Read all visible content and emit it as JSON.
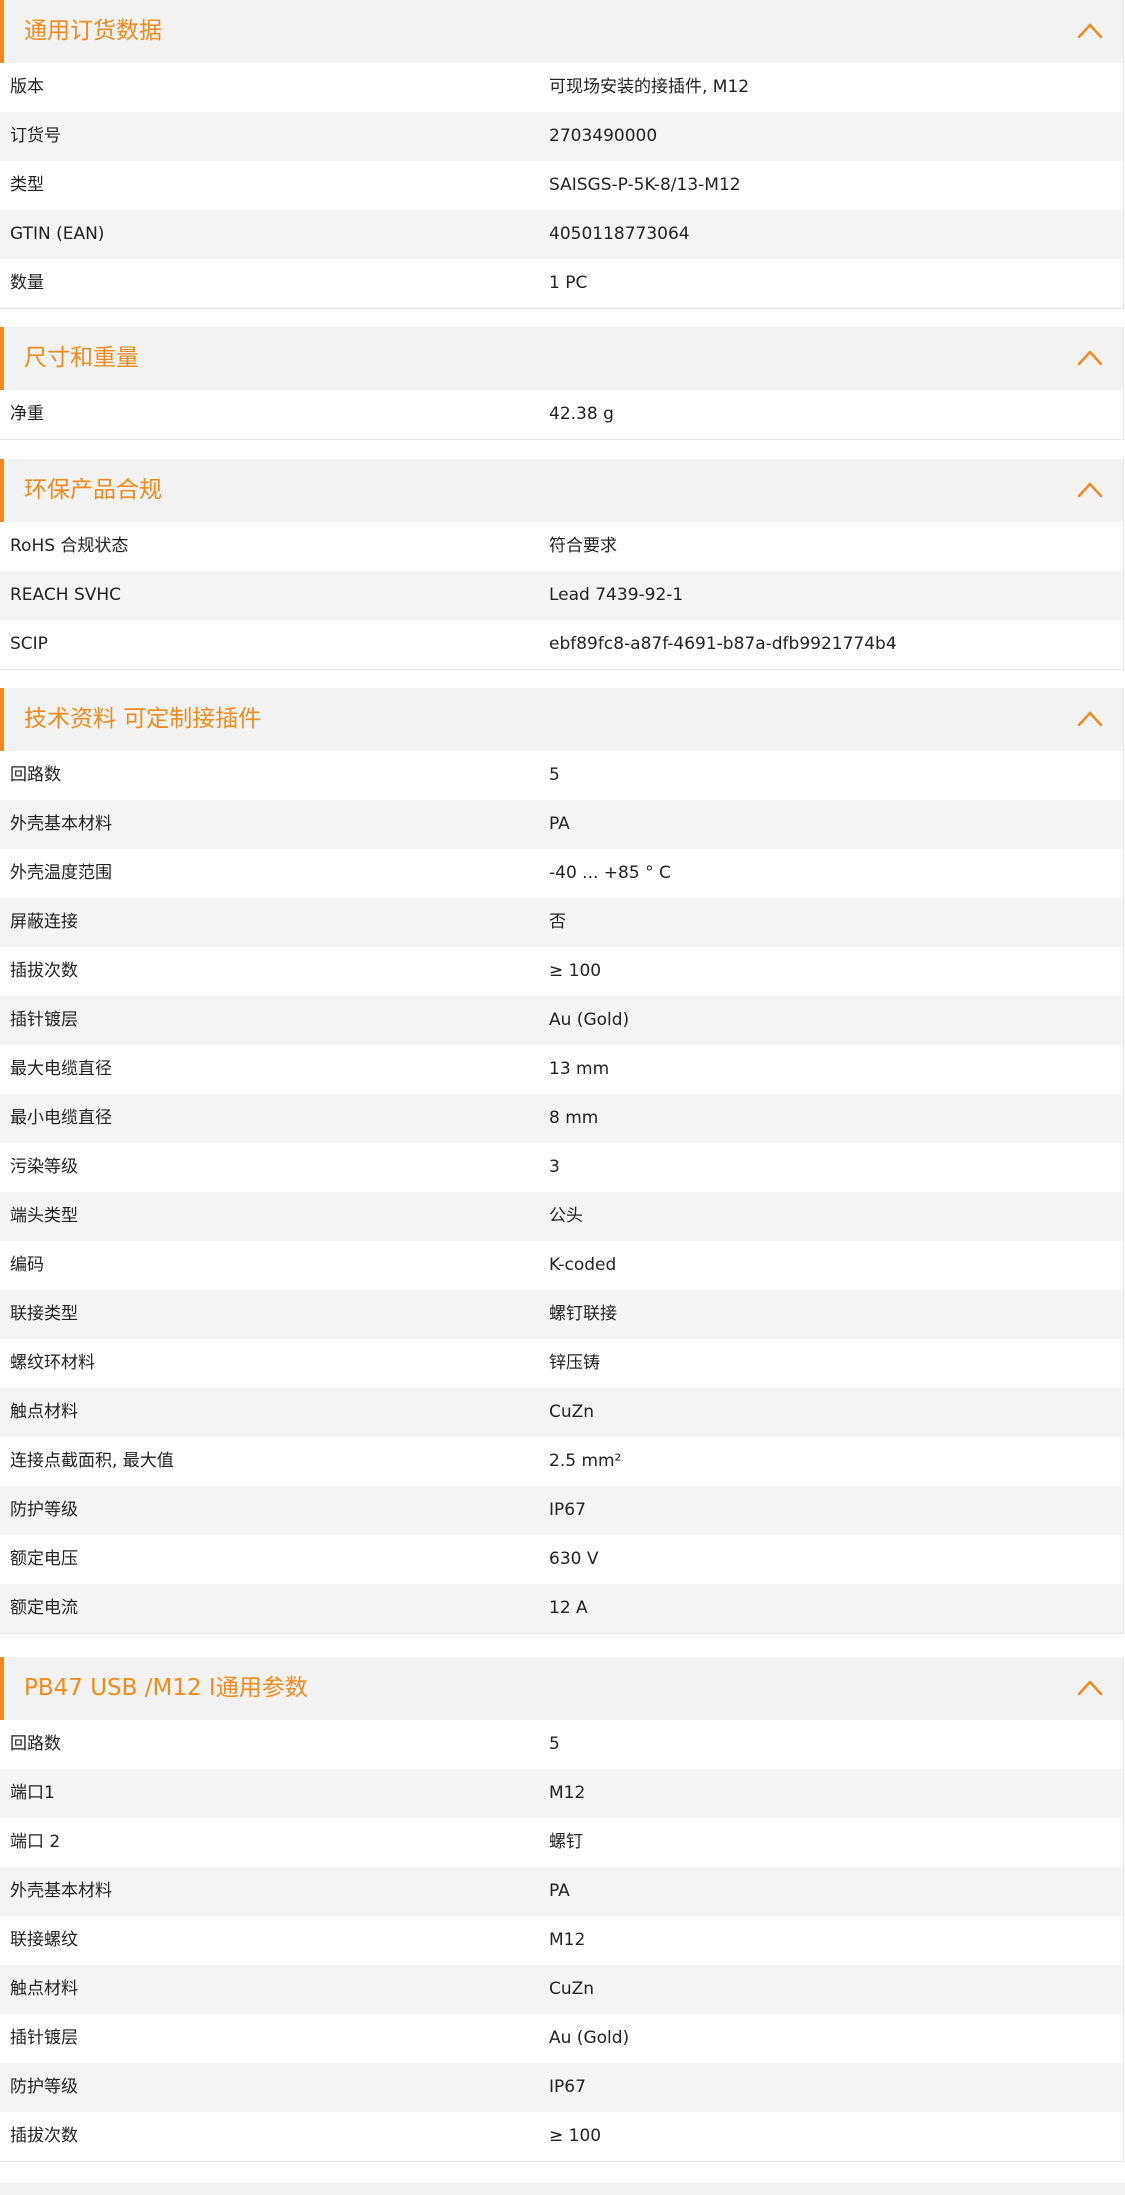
{
  "theme": {
    "accent": "#f08a1c",
    "header_bg": "#f2f2f2",
    "row_alt_bg": "#f4f4f4"
  },
  "sections": [
    {
      "title": "通用订货数据",
      "icon": "chevron-up-icon",
      "rows": [
        {
          "label": "版本",
          "value": "可现场安装的接插件, M12"
        },
        {
          "label": "订货号",
          "value": "2703490000"
        },
        {
          "label": "类型",
          "value": "SAISGS-P-5K-8/13-M12"
        },
        {
          "label": "GTIN (EAN)",
          "value": "4050118773064"
        },
        {
          "label": "数量",
          "value": "1  PC"
        }
      ]
    },
    {
      "title": "尺寸和重量",
      "icon": "chevron-up-icon",
      "rows": [
        {
          "label": "净重",
          "value": "42.38  g"
        }
      ]
    },
    {
      "title": "环保产品合规",
      "icon": "chevron-up-icon",
      "rows": [
        {
          "label": "RoHS 合规状态",
          "value": "符合要求"
        },
        {
          "label": "REACH SVHC",
          "value": "Lead 7439-92-1"
        },
        {
          "label": "SCIP",
          "value": "ebf89fc8-a87f-4691-b87a-dfb9921774b4"
        }
      ]
    },
    {
      "title": "技术资料 可定制接插件",
      "icon": "chevron-up-icon",
      "rows": [
        {
          "label": "回路数",
          "value": "5"
        },
        {
          "label": "外壳基本材料",
          "value": "PA"
        },
        {
          "label": "外壳温度范围",
          "value": "-40 ... +85 ° C"
        },
        {
          "label": "屏蔽连接",
          "value": "否"
        },
        {
          "label": "插拔次数",
          "value": "≥ 100"
        },
        {
          "label": "插针镀层",
          "value": "Au (Gold)"
        },
        {
          "label": "最大电缆直径",
          "value": "13  mm"
        },
        {
          "label": "最小电缆直径",
          "value": "8  mm"
        },
        {
          "label": "污染等级",
          "value": "3"
        },
        {
          "label": "端头类型",
          "value": "公头"
        },
        {
          "label": "编码",
          "value": "K-coded"
        },
        {
          "label": "联接类型",
          "value": "螺钉联接"
        },
        {
          "label": "螺纹环材料",
          "value": "锌压铸"
        },
        {
          "label": "触点材料",
          "value": "CuZn"
        },
        {
          "label": "连接点截面积, 最大值",
          "value": "2.5  mm²"
        },
        {
          "label": "防护等级",
          "value": "IP67"
        },
        {
          "label": "额定电压",
          "value": "630  V"
        },
        {
          "label": "额定电流",
          "value": "12  A"
        }
      ]
    },
    {
      "title": "PB47 USB /M12 I通用参数",
      "icon": "chevron-up-icon",
      "rows": [
        {
          "label": "回路数",
          "value": "5"
        },
        {
          "label": "端口1",
          "value": "M12"
        },
        {
          "label": "端口 2",
          "value": "螺钉"
        },
        {
          "label": "外壳基本材料",
          "value": "PA"
        },
        {
          "label": "联接螺纹",
          "value": "M12"
        },
        {
          "label": "触点材料",
          "value": "CuZn"
        },
        {
          "label": "插针镀层",
          "value": "Au (Gold)"
        },
        {
          "label": "防护等级",
          "value": "IP67"
        },
        {
          "label": "插拔次数",
          "value": "≥ 100"
        }
      ]
    }
  ]
}
